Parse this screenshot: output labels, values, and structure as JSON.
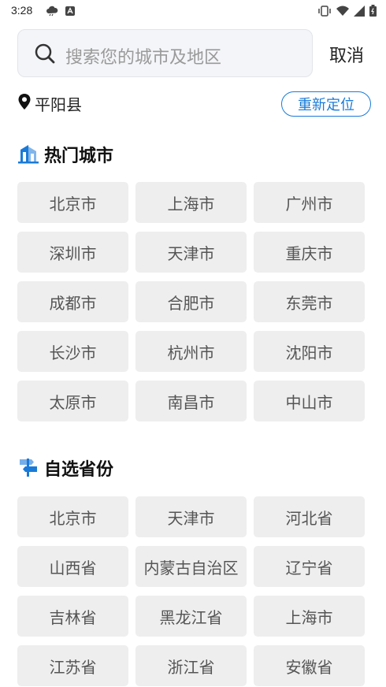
{
  "status": {
    "time": "3:28"
  },
  "search": {
    "placeholder": "搜索您的城市及地区",
    "cancel_label": "取消"
  },
  "location": {
    "current": "平阳县",
    "relocate_label": "重新定位"
  },
  "hot_cities": {
    "title": "热门城市",
    "items": [
      "北京市",
      "上海市",
      "广州市",
      "深圳市",
      "天津市",
      "重庆市",
      "成都市",
      "合肥市",
      "东莞市",
      "长沙市",
      "杭州市",
      "沈阳市",
      "太原市",
      "南昌市",
      "中山市"
    ]
  },
  "provinces": {
    "title": "自选省份",
    "items": [
      "北京市",
      "天津市",
      "河北省",
      "山西省",
      "内蒙古自治区",
      "辽宁省",
      "吉林省",
      "黑龙江省",
      "上海市",
      "江苏省",
      "浙江省",
      "安徽省"
    ]
  },
  "colors": {
    "accent": "#1a7ad8",
    "chip_bg": "#eeeeee"
  },
  "icons": {
    "hot_cities": "building-icon",
    "provinces": "signpost-icon",
    "location": "location-pin-icon"
  }
}
